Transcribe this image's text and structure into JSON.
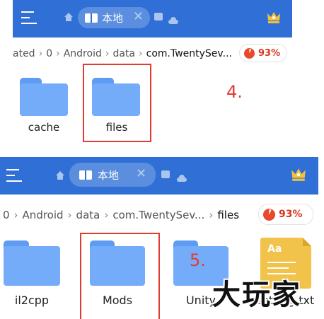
{
  "top_panel": {
    "tab": {
      "label": "本地",
      "close": "✕"
    },
    "breadcrumb": [
      "ated",
      "0",
      "Android",
      "data",
      "com.TwentySev..."
    ],
    "storage_percent": "93%",
    "folders": [
      {
        "name": "cache"
      },
      {
        "name": "files"
      }
    ],
    "step_label": "4."
  },
  "bottom_panel": {
    "tab": {
      "label": "本地",
      "close": "✕"
    },
    "breadcrumb": [
      "0",
      "Android",
      "data",
      "com.TwentySev...",
      "files"
    ],
    "storage_percent": "93%",
    "items": [
      {
        "name": "il2cpp",
        "kind": "folder"
      },
      {
        "name": "Mods",
        "kind": "folder"
      },
      {
        "name": "Unity",
        "kind": "folder"
      },
      {
        "name": "setting.txt",
        "kind": "text-file"
      }
    ],
    "step_label": "5.",
    "txt_icon_text": "Aa"
  },
  "watermark": "大玩家",
  "colors": {
    "toolbar": "#2f6fd6",
    "folder": "#74acfa",
    "highlight": "#e03c31",
    "storage": "#e8492d",
    "crown": "#f3c23a"
  },
  "icons": {
    "menu": "menu-icon",
    "home": "home-icon",
    "tab": "folder-tab-icon",
    "chat": "chat-icon",
    "cloud": "cloud-icon",
    "crown": "crown-icon",
    "pie": "storage-pie-icon"
  }
}
